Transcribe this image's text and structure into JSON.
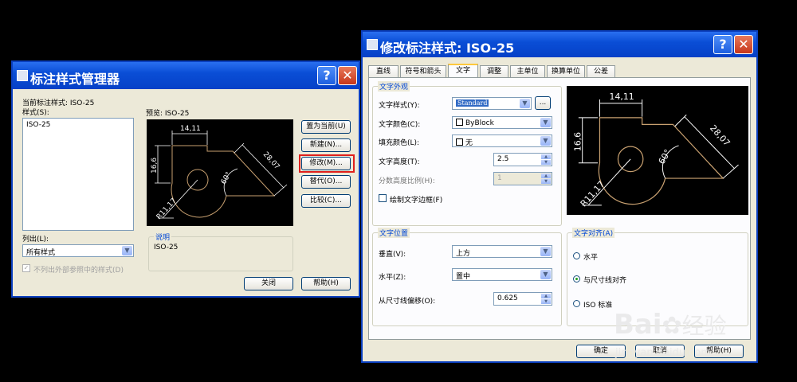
{
  "manager": {
    "title": "标注样式管理器",
    "current_style_label": "当前标注样式: ISO-25",
    "styles_label": "样式(S):",
    "styles": [
      "ISO-25"
    ],
    "preview_label": "预览: ISO-25",
    "list_label": "列出(L):",
    "list_value": "所有样式",
    "exclude_xref_label": "不列出外部参照中的样式(D)",
    "description_title": "说明",
    "description_text": "ISO-25",
    "buttons": {
      "set_current": "置为当前(U)",
      "new": "新建(N)...",
      "modify": "修改(M)...",
      "override": "替代(O)...",
      "compare": "比较(C)...",
      "close": "关闭",
      "help": "帮助(H)"
    },
    "highlight_color": "#e0201c"
  },
  "modify": {
    "title": "修改标注样式: ISO-25",
    "tabs": [
      "直线",
      "符号和箭头",
      "文字",
      "调整",
      "主单位",
      "换算单位",
      "公差"
    ],
    "active_tab": "文字",
    "appearance": {
      "title": "文字外观",
      "text_style_label": "文字样式(Y):",
      "text_style_value": "Standard",
      "text_style_button": "...",
      "text_color_label": "文字颜色(C):",
      "text_color_value": "ByBlock",
      "fill_color_label": "填充颜色(L):",
      "fill_color_value": "无",
      "text_height_label": "文字高度(T):",
      "text_height_value": "2.5",
      "fraction_scale_label": "分数高度比例(H):",
      "fraction_scale_value": "1",
      "draw_frame_label": "绘制文字边框(F)"
    },
    "placement": {
      "title": "文字位置",
      "vertical_label": "垂直(V):",
      "vertical_value": "上方",
      "horizontal_label": "水平(Z):",
      "horizontal_value": "置中",
      "offset_label": "从尺寸线偏移(O):",
      "offset_value": "0.625"
    },
    "alignment": {
      "title": "文字对齐(A)",
      "options": [
        "水平",
        "与尺寸线对齐",
        "ISO 标准"
      ],
      "selected": "与尺寸线对齐"
    },
    "buttons": {
      "ok": "确定",
      "cancel": "取消",
      "help": "帮助(H)"
    }
  },
  "preview_dims": {
    "width": "14,11",
    "height": "16,6",
    "slant": "28,07",
    "angle": "60°",
    "radius": "R11,17"
  },
  "watermark": {
    "brand": "Bai",
    "brand_cn": "经验",
    "url": "jingyan.baidu.com"
  }
}
